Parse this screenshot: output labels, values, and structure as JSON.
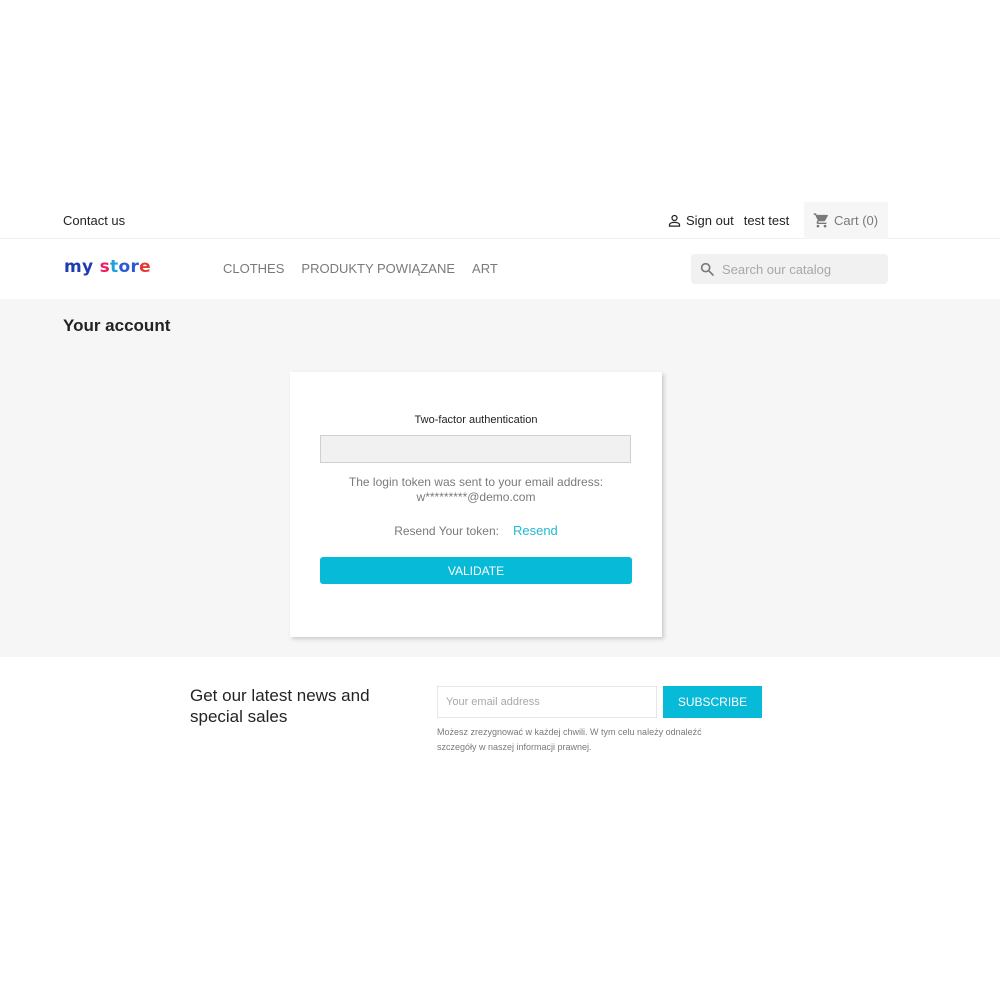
{
  "header": {
    "contact_label": "Contact us",
    "sign_out_label": "Sign out",
    "account_name": "test test",
    "cart_label": "Cart",
    "cart_count": "(0)",
    "logo_text": [
      "m",
      "y",
      " s",
      "t",
      "o",
      "r",
      "e"
    ],
    "menu": [
      {
        "label": "Clothes"
      },
      {
        "label": "Produkty powiązane"
      },
      {
        "label": "Art"
      }
    ],
    "search": {
      "placeholder": "Search our catalog",
      "value": ""
    }
  },
  "main": {
    "page_title": "Your account",
    "twofa": {
      "label": "Two-factor authentication",
      "token_value": "",
      "info_line1": "The login token was sent to your email address:",
      "info_line2": "w*********@demo.com",
      "resend_prompt": "Resend Your token:",
      "resend_link": "Resend",
      "validate_label": "Validate"
    }
  },
  "newsletter": {
    "title": "Get our latest news and special sales",
    "email_placeholder": "Your email address",
    "email_value": "",
    "subscribe_label": "Subscribe",
    "conditions": "Możesz zrezygnować w każdej chwili. W tym celu należy odnaleźć szczegóły w naszej informacji prawnej."
  },
  "colors": {
    "accent": "#07bad7",
    "link": "#24b9d7",
    "background": "#f6f6f6"
  }
}
